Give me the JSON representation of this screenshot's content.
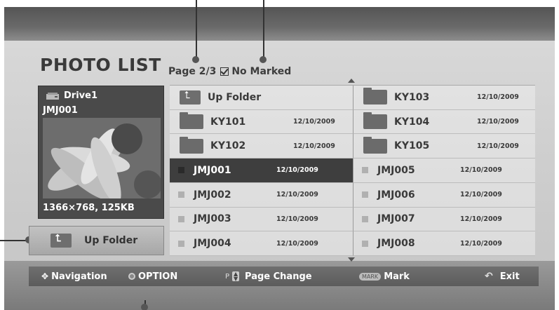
{
  "header": {
    "title": "PHOTO LIST",
    "page_info": "Page 2/3",
    "marked_status": "No Marked"
  },
  "preview": {
    "drive_label": "Drive1",
    "file_name": "JMJ001",
    "resolution_size": "1366×768, 125KB"
  },
  "up_folder_button": {
    "label": "Up Folder"
  },
  "file_list": {
    "left_column": [
      {
        "type": "up-folder",
        "name": "Up Folder",
        "date": ""
      },
      {
        "type": "folder",
        "name": "KY101",
        "date": "12/10/2009"
      },
      {
        "type": "folder",
        "name": "KY102",
        "date": "12/10/2009"
      },
      {
        "type": "photo",
        "name": "JMJ001",
        "date": "12/10/2009",
        "selected": true
      },
      {
        "type": "photo",
        "name": "JMJ002",
        "date": "12/10/2009"
      },
      {
        "type": "photo",
        "name": "JMJ003",
        "date": "12/10/2009"
      },
      {
        "type": "photo",
        "name": "JMJ004",
        "date": "12/10/2009"
      }
    ],
    "right_column": [
      {
        "type": "folder",
        "name": "KY103",
        "date": "12/10/2009"
      },
      {
        "type": "folder",
        "name": "KY104",
        "date": "12/10/2009"
      },
      {
        "type": "folder",
        "name": "KY105",
        "date": "12/10/2009"
      },
      {
        "type": "photo",
        "name": "JMJ005",
        "date": "12/10/2009"
      },
      {
        "type": "photo",
        "name": "JMJ006",
        "date": "12/10/2009"
      },
      {
        "type": "photo",
        "name": "JMJ007",
        "date": "12/10/2009"
      },
      {
        "type": "photo",
        "name": "JMJ008",
        "date": "12/10/2009"
      }
    ]
  },
  "bottom_bar": {
    "navigation": "Navigation",
    "option": "OPTION",
    "page_key": "P",
    "page_change": "Page Change",
    "mark_badge": "MARK",
    "mark": "Mark",
    "exit": "Exit"
  },
  "icons": {
    "drive": "drive-icon",
    "up_folder": "up-folder-icon",
    "folder": "folder-icon",
    "photo_file": "photo-file-icon",
    "navigation": "navigation-arrows-icon",
    "option": "option-button-icon",
    "page_updown": "page-updown-icon",
    "exit": "exit-return-icon"
  }
}
